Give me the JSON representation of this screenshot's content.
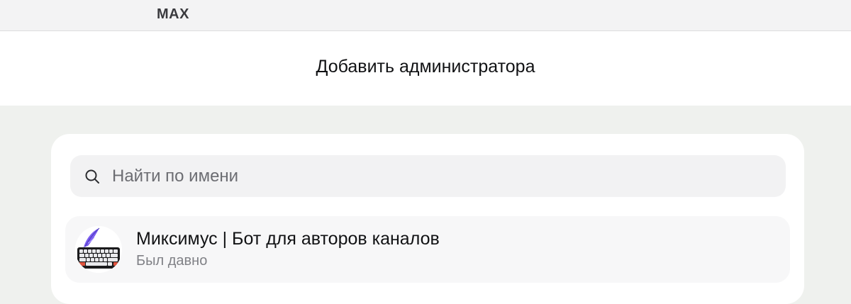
{
  "app": {
    "title": "MAX"
  },
  "dialog": {
    "title": "Добавить администратора"
  },
  "search": {
    "placeholder": "Найти по имени",
    "value": "",
    "icon": "search-icon"
  },
  "contacts": [
    {
      "name": "Миксимус | Бот для авторов каналов",
      "status": "Был давно",
      "avatar_icon": "keyboard-feather-avatar"
    }
  ],
  "colors": {
    "background": "#eff1ee",
    "card": "#ffffff",
    "search_bg": "#f2f2f3",
    "text_primary": "#111214",
    "text_secondary": "#808186"
  }
}
